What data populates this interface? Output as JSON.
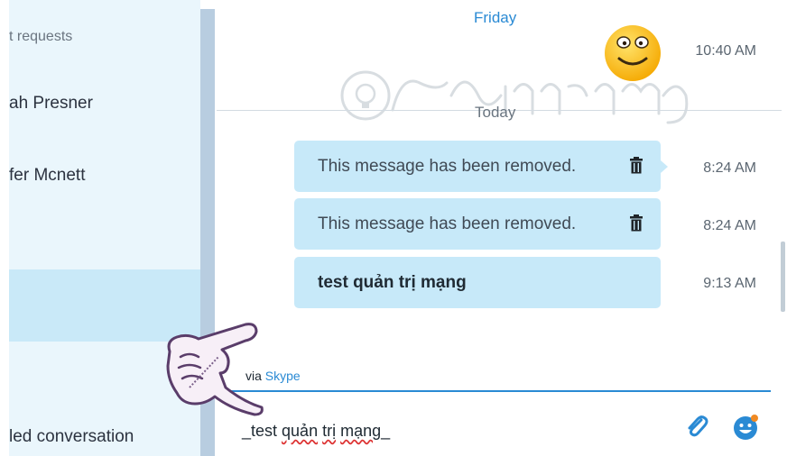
{
  "sidebar": {
    "items": [
      {
        "label": "t requests"
      },
      {
        "label": "ah Presner"
      },
      {
        "label": "fer Mcnett"
      },
      {
        "label": "led conversation"
      }
    ]
  },
  "chat": {
    "days": {
      "friday": "Friday",
      "today": "Today"
    },
    "smiley_time": "10:40 AM",
    "messages": [
      {
        "text": "This message has been removed.",
        "time": "8:24 AM",
        "icon": "trash-icon"
      },
      {
        "text": "This message has been removed.",
        "time": "8:24 AM",
        "icon": "trash-icon"
      },
      {
        "text": "test quản trị mạng",
        "time": "9:13 AM"
      }
    ],
    "via": {
      "prefix": "via ",
      "service": "Skype"
    },
    "compose": {
      "before": "_test ",
      "words": [
        "quản",
        "trị",
        "mạng"
      ],
      "after": "_"
    }
  },
  "colors": {
    "accent": "#2a8ad4",
    "bubble": "#c7e9f9",
    "sidebar": "#eaf6fc",
    "selected": "#c9e9f8"
  },
  "icons": [
    "trash-icon",
    "paperclip-icon",
    "emoji-icon",
    "smiley-emoticon",
    "pointing-hand-icon"
  ]
}
